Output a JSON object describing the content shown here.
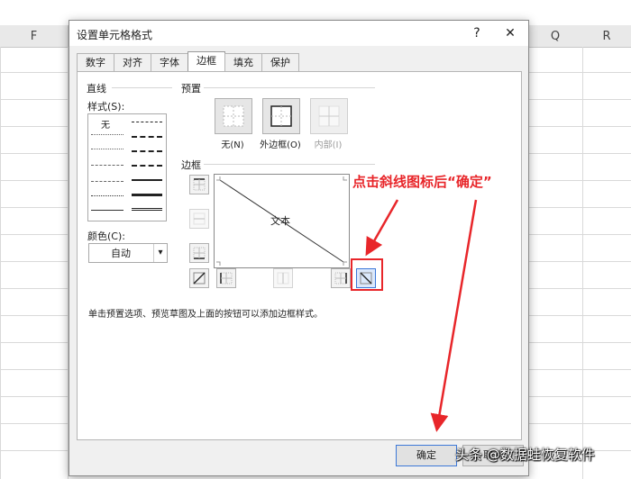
{
  "sheet": {
    "col_f": "F",
    "col_q": "Q",
    "col_r": "R"
  },
  "dialog": {
    "title": "设置单元格格式",
    "help": "?",
    "close": "✕",
    "tabs": [
      "数字",
      "对齐",
      "字体",
      "边框",
      "填充",
      "保护"
    ],
    "active_tab": "边框",
    "line_group": "直线",
    "style_label": "样式(S):",
    "style_none": "无",
    "color_label": "颜色(C):",
    "color_value": "自动",
    "presets_label": "预置",
    "preset_none": "无(N)",
    "preset_outline": "外边框(O)",
    "preset_inside": "内部(I)",
    "border_label": "边框",
    "preview_text": "文本",
    "hint": "单击预置选项、预览草图及上面的按钮可以添加边框样式。",
    "ok": "确定",
    "cancel": "取消"
  },
  "annotation": {
    "text": "点击斜线图标后“确定”",
    "color": "#e8262a"
  },
  "watermark": "头条 @数据蛙恢复软件"
}
